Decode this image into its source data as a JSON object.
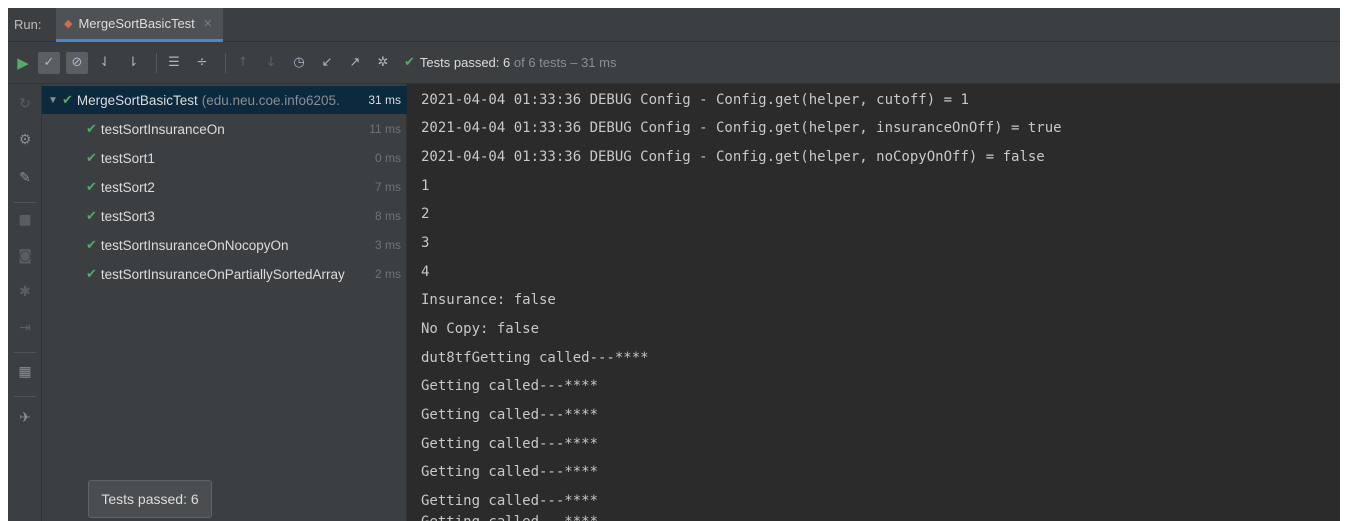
{
  "run_label": "Run:",
  "tab": {
    "title": "MergeSortBasicTest",
    "close": "×"
  },
  "toolbar": {
    "status_prefix": "Tests passed: ",
    "passed_count": "6",
    "status_suffix": " of 6 tests – 31 ms"
  },
  "tree": {
    "root": {
      "name": "MergeSortBasicTest",
      "package": "(edu.neu.coe.info6205.",
      "duration": "31 ms"
    },
    "tests": [
      {
        "name": "testSortInsuranceOn",
        "duration": "11 ms"
      },
      {
        "name": "testSort1",
        "duration": "0 ms"
      },
      {
        "name": "testSort2",
        "duration": "7 ms"
      },
      {
        "name": "testSort3",
        "duration": "8 ms"
      },
      {
        "name": "testSortInsuranceOnNocopyOn",
        "duration": "3 ms"
      },
      {
        "name": "testSortInsuranceOnPartiallySortedArray",
        "duration": "2 ms"
      }
    ]
  },
  "toast": "Tests passed: 6",
  "console": [
    "2021-04-04 01:33:36 DEBUG Config - Config.get(helper, cutoff) = 1",
    "2021-04-04 01:33:36 DEBUG Config - Config.get(helper, insuranceOnOff) = true",
    "2021-04-04 01:33:36 DEBUG Config - Config.get(helper, noCopyOnOff) = false",
    "1",
    "2",
    "3",
    "4",
    "Insurance: false",
    "No Copy: false",
    "dut8tfGetting called---****",
    "Getting called---****",
    "Getting called---****",
    "Getting called---****",
    "Getting called---****",
    "Getting called---****",
    "Getting called---****"
  ],
  "colors": {
    "pass_green": "#59a869",
    "selection": "#0d293e",
    "tab_underline": "#4a88c7"
  }
}
